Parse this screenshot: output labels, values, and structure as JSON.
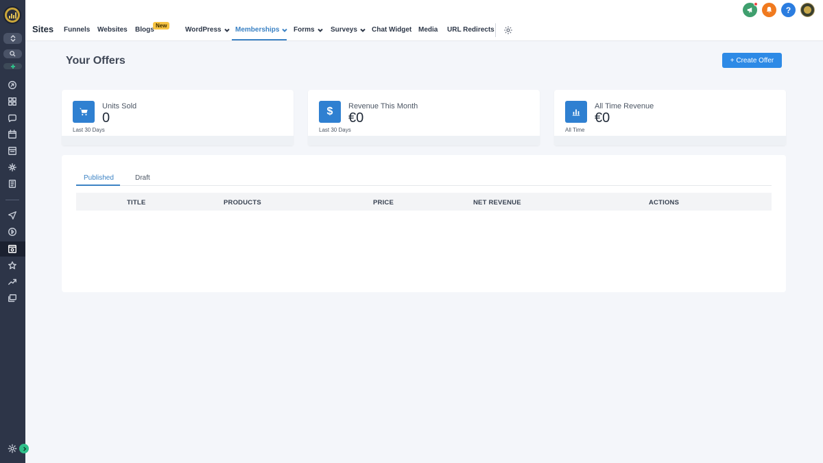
{
  "app": {
    "section_title": "Sites"
  },
  "nav": {
    "items": [
      {
        "label": "Funnels"
      },
      {
        "label": "Websites"
      },
      {
        "label": "Blogs",
        "badge": "New"
      },
      {
        "label": "WordPress"
      },
      {
        "label": "Memberships",
        "active": true
      },
      {
        "label": "Forms"
      },
      {
        "label": "Surveys"
      },
      {
        "label": "Chat Widget"
      },
      {
        "label": "Media"
      },
      {
        "label": "URL Redirects"
      }
    ]
  },
  "topbar": {
    "icons": [
      "megaphone-icon",
      "bell-icon",
      "help-icon",
      "avatar"
    ],
    "help_label": "?"
  },
  "page": {
    "title": "Your Offers",
    "create_button": "+ Create Offer"
  },
  "stats": [
    {
      "icon": "cart-icon",
      "label": "Units Sold",
      "value": "0",
      "sub": "Last 30 Days"
    },
    {
      "icon": "dollar-icon",
      "label": "Revenue This Month",
      "value": "€0",
      "sub": "Last 30 Days"
    },
    {
      "icon": "bar-chart-icon",
      "label": "All Time Revenue",
      "value": "€0",
      "sub": "All Time"
    }
  ],
  "offers": {
    "tabs": [
      {
        "label": "Published",
        "active": true
      },
      {
        "label": "Draft"
      }
    ],
    "columns": [
      "TITLE",
      "PRODUCTS",
      "PRICE",
      "NET REVENUE",
      "ACTIONS"
    ],
    "rows": []
  },
  "colors": {
    "sidebar": "#2d3548",
    "accent": "#3b82c4",
    "primary_button": "#2d8ae6",
    "stat_icon": "#2f80d1",
    "badge_new": "#f6c343"
  }
}
